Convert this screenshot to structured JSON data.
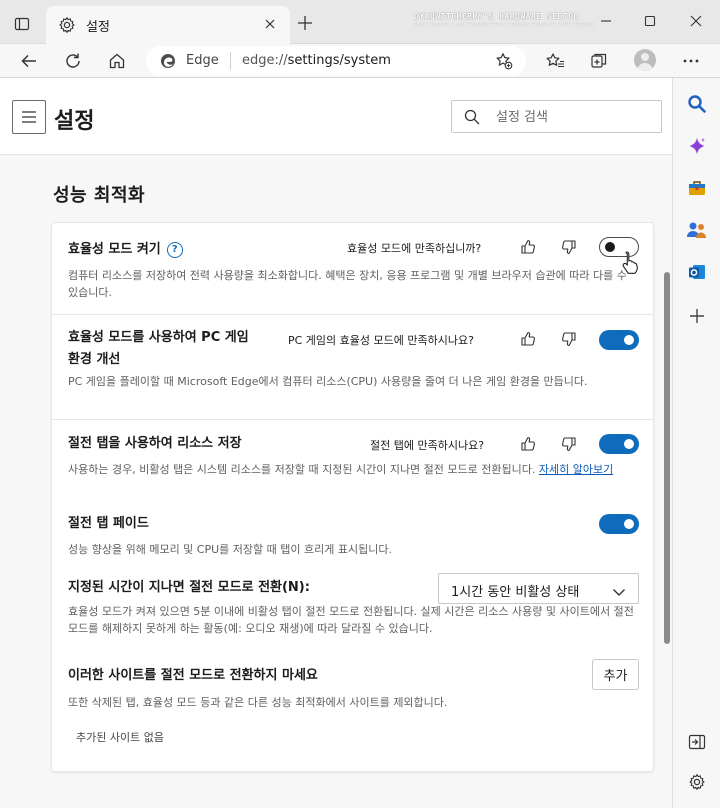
{
  "browser": {
    "tab_title": "설정",
    "new_tab_label": "+",
    "watermark_title": "DYAUWITCHERRY'S HARDWARE SECTOR",
    "watermark_sub": "BLOG COPYRIGHT © 2010 DYAUWITCHERRY'S HARDWARE SECTOR ALL RIGHTS RESERVED",
    "address_brand": "Edge",
    "url_scheme": "edge://",
    "url_path": "settings/system"
  },
  "header": {
    "title": "설정",
    "search_placeholder": "설정 검색"
  },
  "section": {
    "title": "성능 최적화"
  },
  "rows": [
    {
      "title": "효율성 모드 켜기",
      "help_glyph": "?",
      "feedback": "효율성 모드에 만족하십니까?",
      "description": "컴퓨터 리소스를 저장하여 전력 사용량을 최소화합니다. 혜택은 장치, 응용 프로그램 및 개별 브라우저 습관에 따라 다를 수 있습니다.",
      "toggle_on": false
    },
    {
      "title_line1": "효율성 모드를 사용하여 PC 게임",
      "title_line2": "환경 개선",
      "feedback": "PC 게임의 효율성 모드에 만족하시나요?",
      "description": "PC 게임을 플레이할 때 Microsoft Edge에서 컴퓨터 리소스(CPU) 사용량을 줄여 더 나은 게임 환경을 만듭니다.",
      "toggle_on": true
    },
    {
      "title": "절전 탭을 사용하여 리소스 저장",
      "feedback": "절전 탭에 만족하시나요?",
      "description": "사용하는 경우, 비활성 탭은 시스템 리소스를 저장할 때 지정된 시간이 지나면 절전 모드로 전환됩니다.",
      "link": "자세히 알아보기",
      "toggle_on": true
    },
    {
      "title": "절전 탭 페이드",
      "description": "성능 향상을 위해 메모리 및 CPU를 저장할 때 탭이 흐리게 표시됩니다.",
      "toggle_on": true
    },
    {
      "title": "지정된 시간이 지나면 절전 모드로 전환(N):",
      "select_value": "1시간 동안 비활성 상태",
      "description": "효율성 모드가 켜져 있으면 5분 이내에 비활성 탭이 절전 모드로 전환됩니다. 실제 시간은 리소스 사용량 및 사이트에서 절전 모드를 해제하지 못하게 하는 활동(예: 오디오 재생)에 따라 달라질 수 있습니다."
    },
    {
      "title": "이러한 사이트를 절전 모드로 전환하지 마세요",
      "button_label": "추가",
      "description": "또한 삭제된 탭, 효율성 모드 등과 같은 다른 성능 최적화에서 사이트를 제외합니다.",
      "empty_text": "추가된 사이트 없음"
    }
  ],
  "colors": {
    "accent": "#0f6cbd",
    "toggle_off_border": "#4a4a4a"
  },
  "icons": {
    "sidebar": [
      "search-icon",
      "copilot-icon",
      "shopping-icon",
      "people-icon",
      "outlook-icon",
      "add-icon",
      "sidebar-collapse-icon",
      "settings-icon"
    ],
    "toolbar": [
      "back-icon",
      "refresh-icon",
      "home-icon",
      "favorite-add-icon",
      "favorites-icon",
      "collections-icon",
      "profile-icon",
      "more-icon"
    ]
  }
}
